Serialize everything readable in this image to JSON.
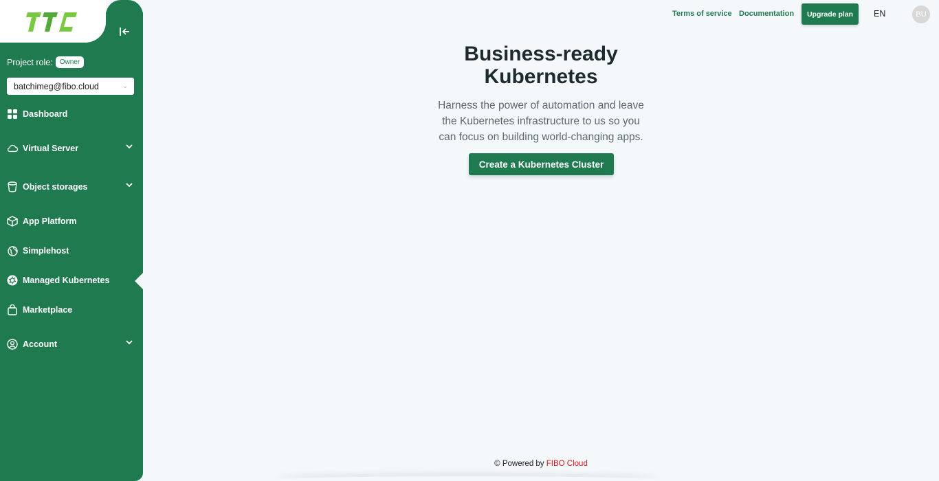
{
  "brand": {
    "logo_text": "TTC",
    "logo_color": "#7ac943"
  },
  "colors": {
    "primary": "#1f7a4f",
    "background": "#f4f8fb",
    "accent_red": "#d4161b"
  },
  "sidebar": {
    "collapse_icon": "collapse-left-icon",
    "project_role_label": "Project role:",
    "project_role_value": "Owner",
    "project_select_value": "batchimeg@fibo.cloud",
    "items": [
      {
        "label": "Dashboard",
        "icon": "grid-icon",
        "has_chevron": false
      },
      {
        "label": "Virtual Server",
        "icon": "cloud-icon",
        "has_chevron": true
      },
      {
        "label": "Object storages",
        "icon": "bucket-icon",
        "has_chevron": true
      },
      {
        "label": "App Platform",
        "icon": "box-icon",
        "has_chevron": false
      },
      {
        "label": "Simplehost",
        "icon": "globe-icon",
        "has_chevron": false
      },
      {
        "label": "Managed Kubernetes",
        "icon": "kubernetes-icon",
        "has_chevron": false,
        "active": true
      },
      {
        "label": "Marketplace",
        "icon": "bag-icon",
        "has_chevron": false
      },
      {
        "label": "Account",
        "icon": "user-circle-icon",
        "has_chevron": true
      }
    ]
  },
  "header": {
    "terms_label": "Terms of service",
    "docs_label": "Documentation",
    "upgrade_label": "Upgrade plan",
    "language": "EN",
    "avatar_initials": "BU"
  },
  "main": {
    "title_line1": "Business-ready",
    "title_line2": "Kubernetes",
    "description_line1": "Harness the power of automation and leave",
    "description_line2": "the Kubernetes infrastructure to us so you",
    "description_line3": "can focus on building world-changing apps.",
    "cta_label": "Create a Kubernetes Cluster"
  },
  "footer": {
    "prefix": "© Powered by",
    "brand": "FIBO Cloud"
  }
}
